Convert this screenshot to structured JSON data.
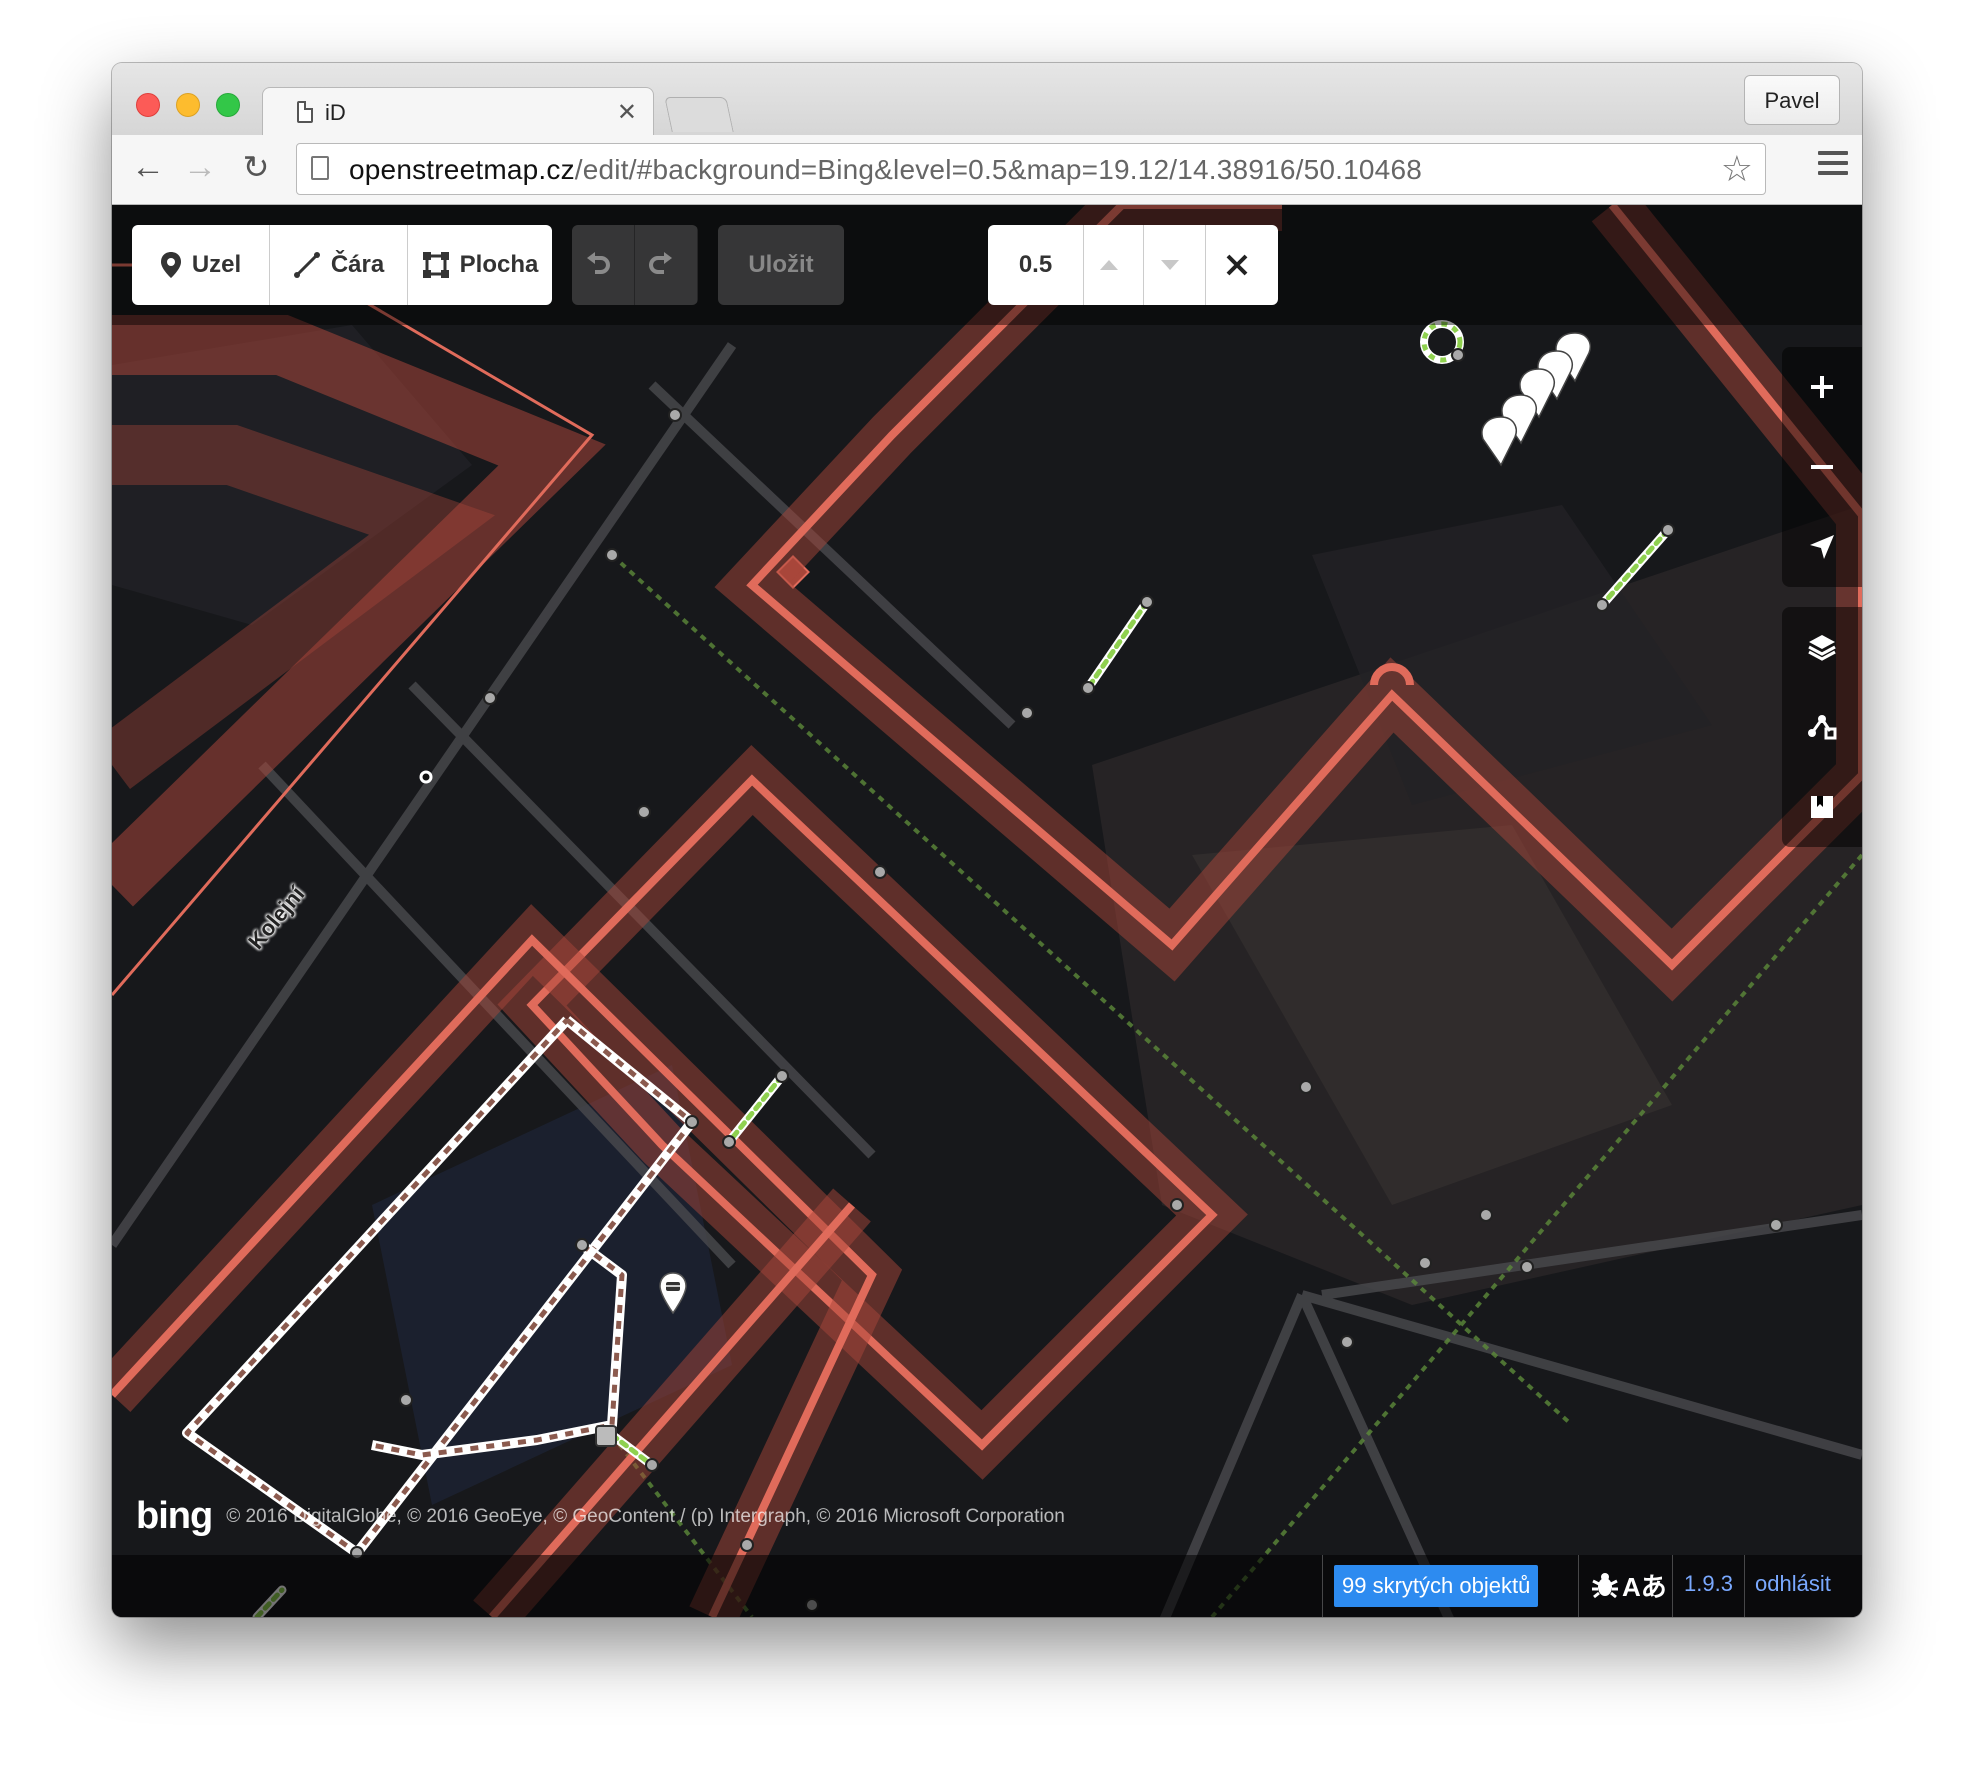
{
  "browser": {
    "tab_title": "iD",
    "profile_name": "Pavel",
    "url_host": "openstreetmap.cz",
    "url_path": "/edit/#background=Bing&level=0.5&map=19.12/14.38916/50.10468"
  },
  "editor": {
    "modes": [
      {
        "label": "Uzel",
        "icon": "point-icon"
      },
      {
        "label": "Čára",
        "icon": "line-icon"
      },
      {
        "label": "Plocha",
        "icon": "area-icon"
      }
    ],
    "save_label": "Uložit",
    "level_value": "0.5",
    "street_label": "Kolejní"
  },
  "map_controls": [
    "zoom-in-icon",
    "zoom-out-icon",
    "geolocate-icon",
    "layers-icon",
    "map-data-icon",
    "help-icon"
  ],
  "attribution": {
    "logo": "bing",
    "text": "© 2016 DigitalGlobe, © 2016 GeoEye, © GeoContent / (p) Intergraph, © 2016 Microsoft Corporation"
  },
  "footer": {
    "hidden_features": "99 skrytých objektů",
    "language_glyph": "Aあ",
    "version": "1.9.3",
    "logout": "odhlásit"
  },
  "colors": {
    "building_outline": "#e06b5b",
    "building_fill": "#a8463a",
    "footway": "#8fd14f",
    "accent": "#2d8bf0",
    "link": "#7aa9ff"
  }
}
